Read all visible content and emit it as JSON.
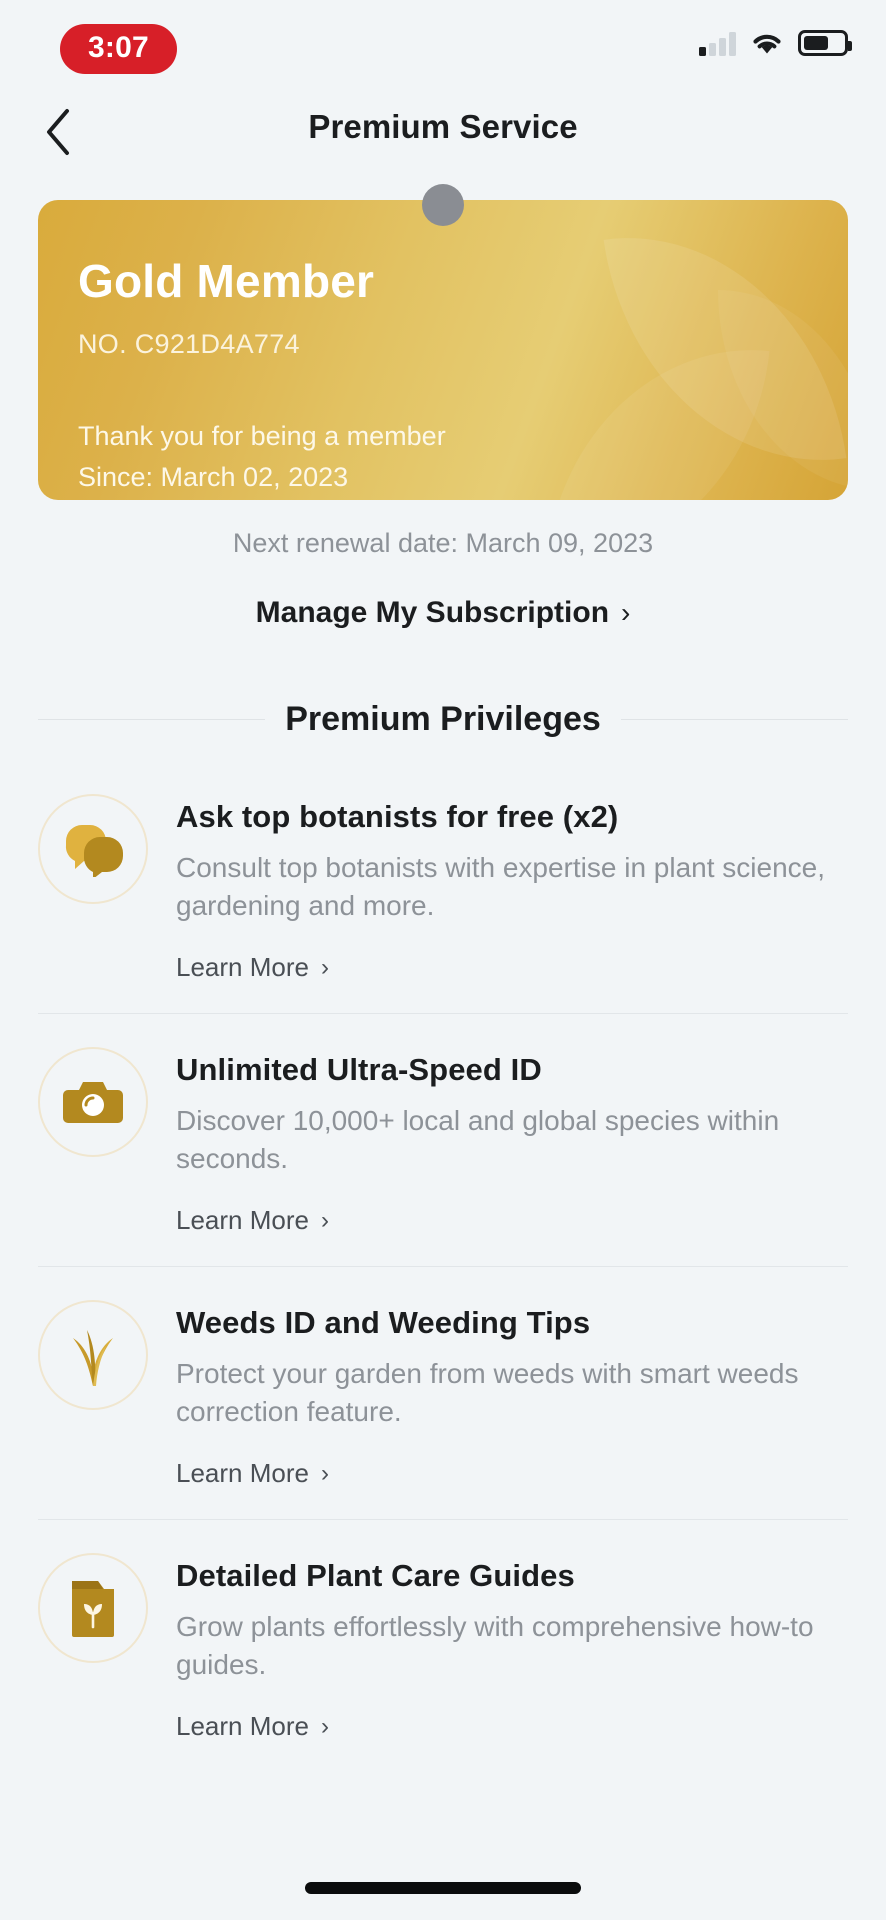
{
  "status_bar": {
    "time": "3:07",
    "time_pill_color": "#d71f28",
    "signal_icon": "cellular-signal-icon",
    "wifi_icon": "wifi-icon",
    "battery_icon": "battery-icon"
  },
  "nav": {
    "back_icon": "back-chevron-icon",
    "title": "Premium Service"
  },
  "card": {
    "tier_title": "Gold Member",
    "member_no": "NO. C921D4A774",
    "thanks_line": "Thank you for being a member",
    "since_line": "Since: March 02, 2023",
    "accent_color": "#d9ab3c",
    "badge_color": "#8a8d93"
  },
  "renewal": {
    "text": "Next renewal date: March 09, 2023"
  },
  "manage": {
    "label": "Manage My Subscription",
    "chevron": "›"
  },
  "section": {
    "title": "Premium Privileges"
  },
  "privileges": [
    {
      "icon": "speech-bubbles-icon",
      "title": "Ask top botanists for free (x2)",
      "desc": "Consult top botanists with expertise in plant science, gardening and more.",
      "learn_more": "Learn More",
      "chevron": "›"
    },
    {
      "icon": "camera-icon",
      "title": "Unlimited Ultra-Speed ID",
      "desc": "Discover 10,000+ local and global species within seconds.",
      "learn_more": "Learn More",
      "chevron": "›"
    },
    {
      "icon": "grass-weeds-icon",
      "title": "Weeds ID and Weeding Tips",
      "desc": "Protect your garden from weeds with smart weeds correction feature.",
      "learn_more": "Learn More",
      "chevron": "›"
    },
    {
      "icon": "plant-guide-folder-icon",
      "title": "Detailed Plant Care Guides",
      "desc": "Grow plants effortlessly with comprehensive how-to guides.",
      "learn_more": "Learn More",
      "chevron": "›"
    }
  ]
}
